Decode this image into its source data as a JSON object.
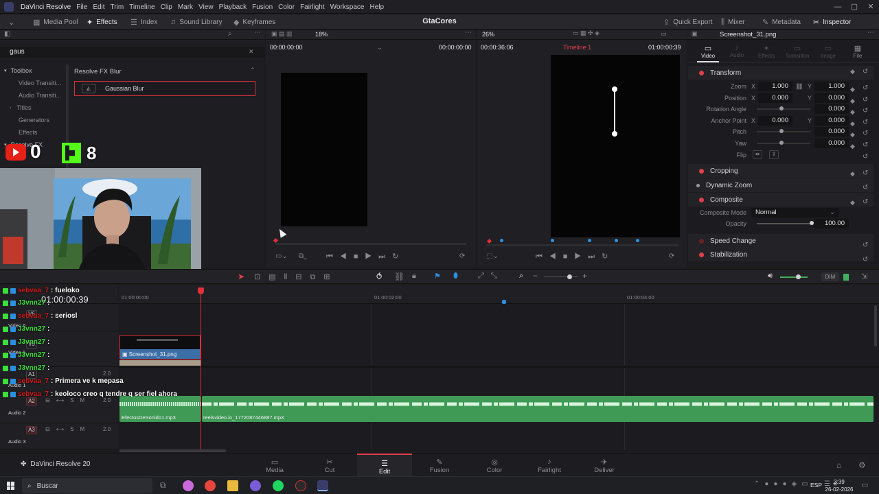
{
  "app": {
    "title": "DaVinci Resolve",
    "menu": [
      "File",
      "Edit",
      "Trim",
      "Timeline",
      "Clip",
      "Mark",
      "View",
      "Playback",
      "Fusion",
      "Color",
      "Fairlight",
      "Workspace",
      "Help"
    ],
    "project_name": "GtaCores"
  },
  "toolbar": {
    "media_pool": "Media Pool",
    "effects": "Effects",
    "index": "Index",
    "sound_library": "Sound Library",
    "keyframes": "Keyframes",
    "quick_export": "Quick Export",
    "mixer": "Mixer",
    "metadata": "Metadata",
    "inspector": "Inspector"
  },
  "effects": {
    "search_value": "gaus",
    "tree": [
      "Toolbox",
      "Video Transiti...",
      "Audio Transiti...",
      "Titles",
      "Generators",
      "Effects",
      "Resolve FX"
    ],
    "category_title": "Resolve FX Blur",
    "result": "Gaussian Blur"
  },
  "overlay": {
    "youtube_count": "0",
    "kick_count": "8",
    "chat": [
      {
        "user": "sebvaa_7",
        "msg": ": fueloko"
      },
      {
        "user": "J3vnn27",
        "msg": ":"
      },
      {
        "user": "sebvaa_7",
        "msg": ": seriosl"
      },
      {
        "user": "J3vnn27",
        "msg": ":"
      },
      {
        "user": "J3vnn27",
        "msg": ":"
      },
      {
        "user": "J3vnn27",
        "msg": ":"
      },
      {
        "user": "J3vnn27",
        "msg": ":"
      },
      {
        "user": "sebvaa_7",
        "msg": ": Primera ve k mepasa"
      },
      {
        "user": "sebvaa_7",
        "msg": ": keoloco creo q tendre q ser fiel ahora"
      }
    ]
  },
  "source_viewer": {
    "zoom": "18%",
    "tc_left": "00:00:00:00",
    "tc_right": "00:00:00:00"
  },
  "timeline_viewer": {
    "zoom": "26%",
    "tc_left": "00:00:36:06",
    "timeline_name": "Timeline 1",
    "tc_right": "01:00:00:39"
  },
  "inspector": {
    "clip_name": "Screenshot_31.png",
    "tabs": [
      "Video",
      "Audio",
      "Effects",
      "Transition",
      "Image",
      "File"
    ],
    "transform": {
      "title": "Transform",
      "zoom_label": "Zoom",
      "zoom_x": "1.000",
      "zoom_y": "1.000",
      "position_label": "Position",
      "pos_x": "0.000",
      "pos_y": "0.000",
      "rotation_label": "Rotation Angle",
      "rotation": "0.000",
      "anchor_label": "Anchor Point",
      "anchor_x": "0.000",
      "anchor_y": "0.000",
      "pitch_label": "Pitch",
      "pitch": "0.000",
      "yaw_label": "Yaw",
      "yaw": "0.000",
      "flip_label": "Flip"
    },
    "cropping": "Cropping",
    "dynamic_zoom": "Dynamic Zoom",
    "composite": {
      "title": "Composite",
      "mode_label": "Composite Mode",
      "mode": "Normal",
      "opacity_label": "Opacity",
      "opacity": "100.00"
    },
    "speed_change": "Speed Change",
    "stabilization": "Stabilization"
  },
  "timeline": {
    "current_tc": "01:00:00:39",
    "ruler": [
      "01:00:00:00",
      "01:00:02:00",
      "01:00:04:00"
    ],
    "tracks": [
      {
        "id": "V6",
        "name": "Video 6"
      },
      {
        "id": "V5",
        "name": "Video 5"
      },
      {
        "id": "A1",
        "name": "Audio 1",
        "level": "2.0"
      },
      {
        "id": "A2",
        "name": "Audio 2",
        "level": "2.0"
      },
      {
        "id": "A3",
        "name": "Audio 3",
        "level": "2.0"
      }
    ],
    "clips": {
      "video": "Screenshot_31.png",
      "audio_a": "EfectosDeSonido1.mp3",
      "audio_b": "reelsvideo.io_1772087446887.mp3"
    },
    "dim_label": "DIM"
  },
  "pages": {
    "product": "DaVinci Resolve 20",
    "items": [
      "Media",
      "Cut",
      "Edit",
      "Fusion",
      "Color",
      "Fairlight",
      "Deliver"
    ],
    "active": "Edit"
  },
  "taskbar": {
    "search_placeholder": "Buscar",
    "lang": "ESP",
    "time": "3:39",
    "date": "26-02-2026"
  },
  "colors": {
    "accent_red": "#e0404a",
    "audio_green": "#3f9a56",
    "video_blue": "#3c6fa8",
    "playhead": "#e0303a"
  }
}
